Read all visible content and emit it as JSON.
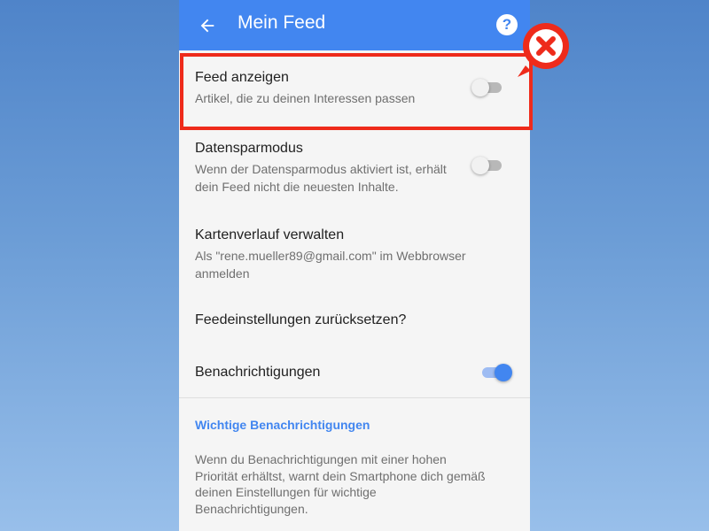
{
  "app_bar": {
    "title": "Mein Feed",
    "back_icon": "arrow-left-icon",
    "help_icon": "help-circle-icon",
    "help_glyph": "?",
    "color": "#4286f0"
  },
  "settings": [
    {
      "title": "Feed anzeigen",
      "subtitle": "Artikel, die zu deinen Interessen passen",
      "toggle": "off",
      "highlighted": true
    },
    {
      "title": "Datensparmodus",
      "subtitle": "Wenn der Datensparmodus aktiviert ist, erhält dein Feed nicht die neuesten Inhalte.",
      "toggle": "off"
    },
    {
      "title": "Kartenverlauf verwalten",
      "subtitle": "Als \"rene.mueller89@gmail.com\" im Webbrowser anmelden"
    },
    {
      "title": "Feedeinstellungen zurücksetzen?"
    },
    {
      "title": "Benachrichtigungen",
      "toggle": "on"
    }
  ],
  "section": {
    "header": "Wichtige Benachrichtigungen",
    "description": "Wenn du Benachrichtigungen mit einer hohen Priorität erhältst, warnt dein Smartphone dich gemäß deinen Einstellungen für wichtige Benachrichtigungen."
  },
  "annotation": {
    "type": "red-x-marker-icon",
    "color": "#ee2b1b"
  }
}
